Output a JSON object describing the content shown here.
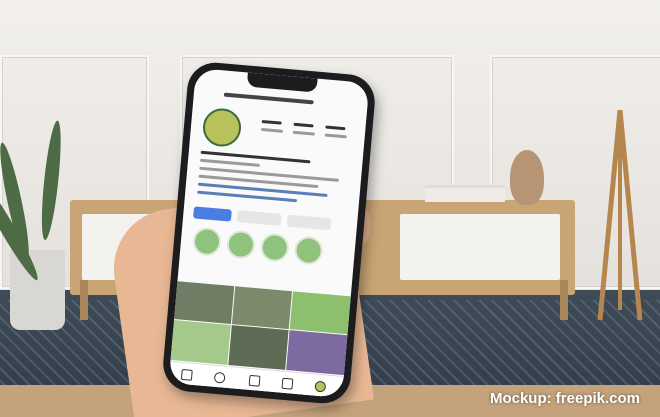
{
  "credit": {
    "text": "Mockup: freepik.com"
  }
}
